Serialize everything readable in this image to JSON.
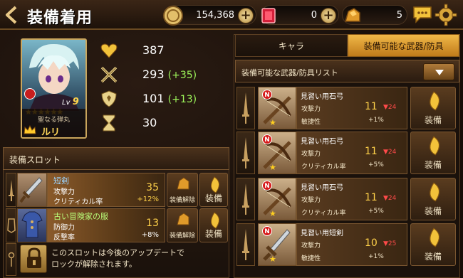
{
  "header": {
    "title": "装備着用",
    "coins": "154,368",
    "gems": "0",
    "gold_ore": "5",
    "plus_label": "+"
  },
  "character": {
    "title_text": "聖なる弾丸",
    "name": "ルリ",
    "level_prefix": "Lv",
    "level": "9",
    "stars": "★★★★★★"
  },
  "stats": [
    {
      "icon": "heart-icon",
      "value": "387",
      "bonus": ""
    },
    {
      "icon": "crossed-swords-icon",
      "value": "293",
      "bonus": "(+35)"
    },
    {
      "icon": "shield-icon",
      "value": "101",
      "bonus": "(+13)"
    },
    {
      "icon": "hourglass-icon",
      "value": "30",
      "bonus": ""
    }
  ],
  "equip_slot": {
    "heading": "装備スロット",
    "items": [
      {
        "name": "短剣",
        "stat1": "攻撃力",
        "stat2": "クリティカル率",
        "value1": "35",
        "value2": "+12%",
        "unequip": "装備解除",
        "equip": "装備"
      },
      {
        "name": "古い冒険家の服",
        "stat1": "防御力",
        "stat2": "反撃率",
        "value1": "13",
        "value2": "+8%",
        "unequip": "装備解除",
        "equip": "装備"
      }
    ],
    "locked_text_1": "このスロットは今後のアップデートで",
    "locked_text_2": "ロックが解除されます。"
  },
  "tabs": {
    "chara": "キャラ",
    "equipable": "装備可能な武器/防具"
  },
  "list": {
    "heading": "装備可能な武器/防具リスト",
    "items": [
      {
        "rarity": "N",
        "name": "見習い用石弓",
        "stat1": "攻撃力",
        "stat2": "敏捷性",
        "value": "11",
        "down": "▼24",
        "pct": "+1%",
        "equip": "装備"
      },
      {
        "rarity": "N",
        "name": "見習い用石弓",
        "stat1": "攻撃力",
        "stat2": "クリティカル率",
        "value": "11",
        "down": "▼24",
        "pct": "+5%",
        "equip": "装備"
      },
      {
        "rarity": "N",
        "name": "見習い用石弓",
        "stat1": "攻撃力",
        "stat2": "クリティカル率",
        "value": "11",
        "down": "▼24",
        "pct": "+5%",
        "equip": "装備"
      },
      {
        "rarity": "N",
        "name": "見習い用短剣",
        "stat1": "攻撃力",
        "stat2": "敏捷性",
        "value": "10",
        "down": "▼25",
        "pct": "+1%",
        "equip": "装備"
      }
    ]
  },
  "colors": {
    "gold": "#ffd24a",
    "bonus_green": "#9df55a",
    "down_red": "#ff4a4a",
    "tab_active": "#e0a030"
  }
}
